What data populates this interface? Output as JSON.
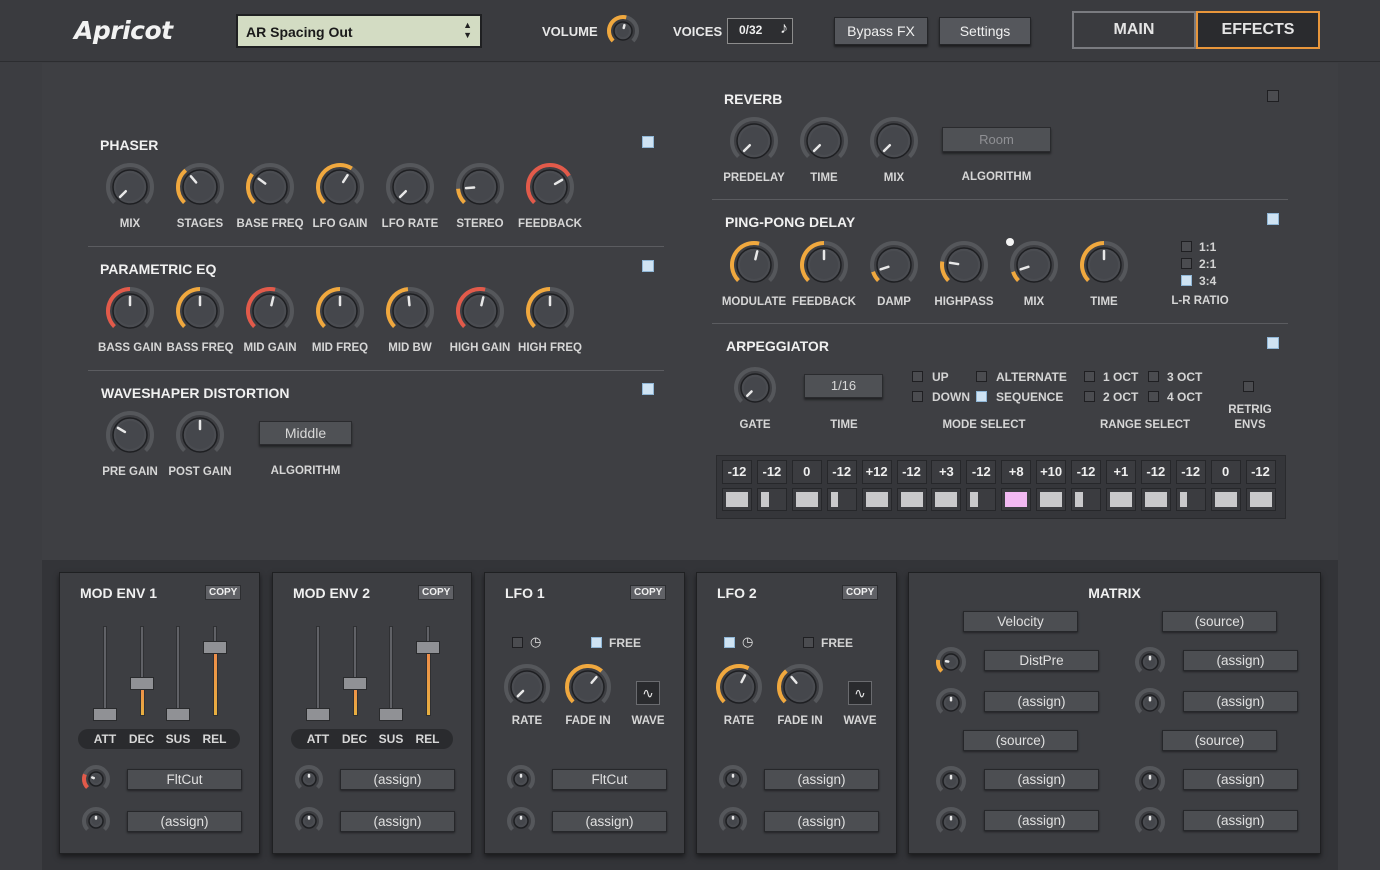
{
  "header": {
    "brand": "Apricot",
    "preset": "AR Spacing Out",
    "volume_label": "VOLUME",
    "voices_label": "VOICES",
    "voices_value": "0/32",
    "bypass_label": "Bypass FX",
    "settings_label": "Settings",
    "tab_main": "MAIN",
    "tab_effects": "EFFECTS",
    "active_tab": "EFFECTS"
  },
  "colors": {
    "accent": "#e8963b",
    "knob_arc_light": "#f2b040",
    "knob_arc_red": "#e25a4a",
    "panel": "#3e3f43",
    "indicator_on": "#cfe3f3",
    "step_highlight": "#f2b9f2"
  },
  "phaser": {
    "title": "PHASER",
    "enabled": true,
    "knobs": [
      {
        "label": "MIX",
        "value": 0.0
      },
      {
        "label": "STAGES",
        "value": 0.35
      },
      {
        "label": "BASE FREQ",
        "value": 0.3
      },
      {
        "label": "LFO GAIN",
        "value": 0.62
      },
      {
        "label": "LFO RATE",
        "value": 0.0
      },
      {
        "label": "STEREO",
        "value": 0.15
      },
      {
        "label": "FEEDBACK",
        "value": 0.72
      }
    ]
  },
  "eq": {
    "title": "PARAMETRIC EQ",
    "enabled": true,
    "knobs": [
      {
        "label": "BASS GAIN",
        "value": 0.5
      },
      {
        "label": "BASS FREQ",
        "value": 0.5
      },
      {
        "label": "MID GAIN",
        "value": 0.55
      },
      {
        "label": "MID FREQ",
        "value": 0.5
      },
      {
        "label": "MID BW",
        "value": 0.48
      },
      {
        "label": "HIGH GAIN",
        "value": 0.55
      },
      {
        "label": "HIGH FREQ",
        "value": 0.5
      }
    ]
  },
  "waveshaper": {
    "title": "WAVESHAPER DISTORTION",
    "enabled": true,
    "knobs": [
      {
        "label": "PRE GAIN",
        "value": 0.28
      },
      {
        "label": "POST GAIN",
        "value": 0.5
      }
    ],
    "algorithm": "Middle",
    "algorithm_label": "ALGORITHM"
  },
  "reverb": {
    "title": "REVERB",
    "enabled": false,
    "knobs": [
      {
        "label": "PREDELAY",
        "value": 0.0
      },
      {
        "label": "TIME",
        "value": 0.0
      },
      {
        "label": "MIX",
        "value": 0.0
      }
    ],
    "algorithm": "Room",
    "algorithm_label": "ALGORITHM"
  },
  "delay": {
    "title": "PING-PONG DELAY",
    "enabled": true,
    "knobs": [
      {
        "label": "MODULATE",
        "value": 0.55
      },
      {
        "label": "FEEDBACK",
        "value": 0.5
      },
      {
        "label": "DAMP",
        "value": 0.1
      },
      {
        "label": "HIGHPASS",
        "value": 0.2
      },
      {
        "label": "MIX",
        "value": 0.1
      },
      {
        "label": "TIME",
        "value": 0.5
      }
    ],
    "ratio_label": "L-R RATIO",
    "ratios": [
      {
        "label": "1:1",
        "on": false
      },
      {
        "label": "2:1",
        "on": false
      },
      {
        "label": "3:4",
        "on": true
      }
    ]
  },
  "arp": {
    "title": "ARPEGGIATOR",
    "enabled": true,
    "gate_label": "GATE",
    "time_value": "1/16",
    "time_label": "TIME",
    "mode_label": "MODE SELECT",
    "range_label": "RANGE SELECT",
    "retrig_label": "RETRIG",
    "envs_label": "ENVS",
    "modes": [
      {
        "label": "UP",
        "on": false
      },
      {
        "label": "DOWN",
        "on": false
      },
      {
        "label": "ALTERNATE",
        "on": false
      },
      {
        "label": "SEQUENCE",
        "on": true
      }
    ],
    "ranges": [
      {
        "label": "1 OCT",
        "on": false
      },
      {
        "label": "2 OCT",
        "on": false
      },
      {
        "label": "3 OCT",
        "on": false
      },
      {
        "label": "4 OCT",
        "on": false
      }
    ],
    "retrig_on": false,
    "steps": [
      {
        "v": "-12",
        "g": 1.0
      },
      {
        "v": "-12",
        "g": 0.35
      },
      {
        "v": "0",
        "g": 1.0
      },
      {
        "v": "-12",
        "g": 0.35
      },
      {
        "v": "+12",
        "g": 1.0
      },
      {
        "v": "-12",
        "g": 1.0
      },
      {
        "v": "+3",
        "g": 1.0
      },
      {
        "v": "-12",
        "g": 0.35
      },
      {
        "v": "+8",
        "g": 1.0,
        "hl": true
      },
      {
        "v": "+10",
        "g": 1.0
      },
      {
        "v": "-12",
        "g": 0.35
      },
      {
        "v": "+1",
        "g": 1.0
      },
      {
        "v": "-12",
        "g": 1.0
      },
      {
        "v": "-12",
        "g": 0.35
      },
      {
        "v": "0",
        "g": 1.0
      },
      {
        "v": "-12",
        "g": 1.0
      }
    ]
  },
  "modenv1": {
    "title": "MOD ENV 1",
    "copy": "COPY",
    "faders": [
      {
        "label": "ATT",
        "value": 0.0,
        "color": "none"
      },
      {
        "label": "DEC",
        "value": 0.38,
        "color": "orange"
      },
      {
        "label": "SUS",
        "value": 0.0,
        "color": "none"
      },
      {
        "label": "REL",
        "value": 0.82,
        "color": "orange"
      }
    ],
    "slots": [
      "FltCut",
      "(assign)"
    ],
    "slot_knobs": [
      0.25,
      0.5
    ]
  },
  "modenv2": {
    "title": "MOD ENV 2",
    "copy": "COPY",
    "faders": [
      {
        "label": "ATT",
        "value": 0.0,
        "color": "none"
      },
      {
        "label": "DEC",
        "value": 0.38,
        "color": "orange"
      },
      {
        "label": "SUS",
        "value": 0.0,
        "color": "none"
      },
      {
        "label": "REL",
        "value": 0.82,
        "color": "orange"
      }
    ],
    "slots": [
      "(assign)",
      "(assign)"
    ],
    "slot_knobs": [
      0.5,
      0.5
    ]
  },
  "lfo1": {
    "title": "LFO 1",
    "copy": "COPY",
    "sync_on": false,
    "free_label": "FREE",
    "free_on": true,
    "knobs": [
      {
        "label": "RATE",
        "value": 0.0
      },
      {
        "label": "FADE IN",
        "value": 0.65
      }
    ],
    "wave_label": "WAVE",
    "slots": [
      "FltCut",
      "(assign)"
    ],
    "slot_knobs": [
      0.5,
      0.5
    ]
  },
  "lfo2": {
    "title": "LFO 2",
    "copy": "COPY",
    "sync_on": true,
    "free_label": "FREE",
    "free_on": false,
    "knobs": [
      {
        "label": "RATE",
        "value": 0.6
      },
      {
        "label": "FADE IN",
        "value": 0.35
      }
    ],
    "wave_label": "WAVE",
    "slots": [
      "(assign)",
      "(assign)"
    ],
    "slot_knobs": [
      0.5,
      0.5
    ]
  },
  "matrix": {
    "title": "MATRIX",
    "groups": [
      {
        "source": "Velocity",
        "slots": [
          "DistPre",
          "(assign)"
        ],
        "knobs": [
          0.2,
          0.5
        ]
      },
      {
        "source": "(source)",
        "slots": [
          "(assign)",
          "(assign)"
        ],
        "knobs": [
          0.5,
          0.5
        ]
      },
      {
        "source": "(source)",
        "slots": [
          "(assign)",
          "(assign)"
        ],
        "knobs": [
          0.5,
          0.5
        ]
      },
      {
        "source": "(source)",
        "slots": [
          "(assign)",
          "(assign)"
        ],
        "knobs": [
          0.5,
          0.5
        ]
      }
    ]
  }
}
